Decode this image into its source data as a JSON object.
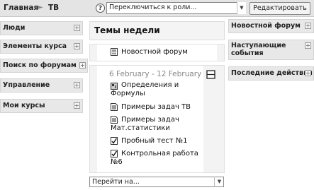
{
  "breadcrumb": {
    "home": "Главная",
    "separator": "►",
    "current": "ТВ"
  },
  "help": {
    "label": "?"
  },
  "role_switch": {
    "value": "Переключиться к роли..."
  },
  "edit_button": {
    "label": "Редактировать"
  },
  "left_blocks": [
    {
      "title": "Люди"
    },
    {
      "title": "Элементы курса"
    },
    {
      "title": "Поиск по форумам"
    },
    {
      "title": "Управление"
    },
    {
      "title": "Мои курсы"
    }
  ],
  "right_blocks": [
    {
      "title": "Новостной форум"
    },
    {
      "title_line1": "Наступающие",
      "title_line2": "события"
    },
    {
      "title": "Последние действия"
    }
  ],
  "plus_symbol": "+",
  "main": {
    "heading": "Темы недели",
    "section0": {
      "items": [
        {
          "icon": "forum-icon",
          "label": "Новостной форум"
        }
      ]
    },
    "section1": {
      "dates": "6 February - 12 February",
      "items": [
        {
          "icon": "resource-icon",
          "line1": "Определения и",
          "line2": "Формулы"
        },
        {
          "icon": "page-icon",
          "line1": "Примеры задач ТВ"
        },
        {
          "icon": "page-icon",
          "line1": "Примеры задач",
          "line2": "Мат.статистики"
        },
        {
          "icon": "quiz-icon",
          "line1": "Пробный тест №1"
        },
        {
          "icon": "quiz-icon",
          "line1": "Контрольная работа",
          "line2": "№6"
        }
      ]
    }
  },
  "jump_menu": {
    "value": "Перейти на..."
  }
}
